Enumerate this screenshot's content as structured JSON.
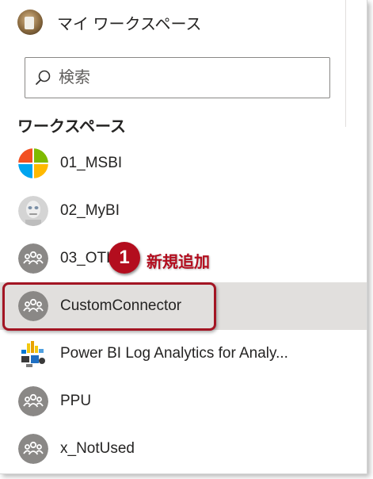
{
  "my_workspace": {
    "label": "マイ ワークスペース",
    "icon": "user-photo-avatar"
  },
  "search": {
    "placeholder": "検索",
    "icon": "search-icon"
  },
  "workspaces": {
    "title": "ワークスペース",
    "items": [
      {
        "label": "01_MSBI",
        "icon": "four-square-logo"
      },
      {
        "label": "02_MyBI",
        "icon": "robot-photo-avatar"
      },
      {
        "label": "03_OTH",
        "icon": "group-icon"
      },
      {
        "label": "CustomConnector",
        "icon": "group-icon",
        "selected": true
      },
      {
        "label": "Power BI Log Analytics for Analy...",
        "icon": "log-analytics-logo"
      },
      {
        "label": "PPU",
        "icon": "group-icon"
      },
      {
        "label": "x_NotUsed",
        "icon": "group-icon"
      }
    ]
  },
  "annotation": {
    "number": "1",
    "text": "新規追加",
    "color": "#b30d1e"
  },
  "colors": {
    "selected_row": "#e1dfdd",
    "group_icon": "#8a8886"
  }
}
